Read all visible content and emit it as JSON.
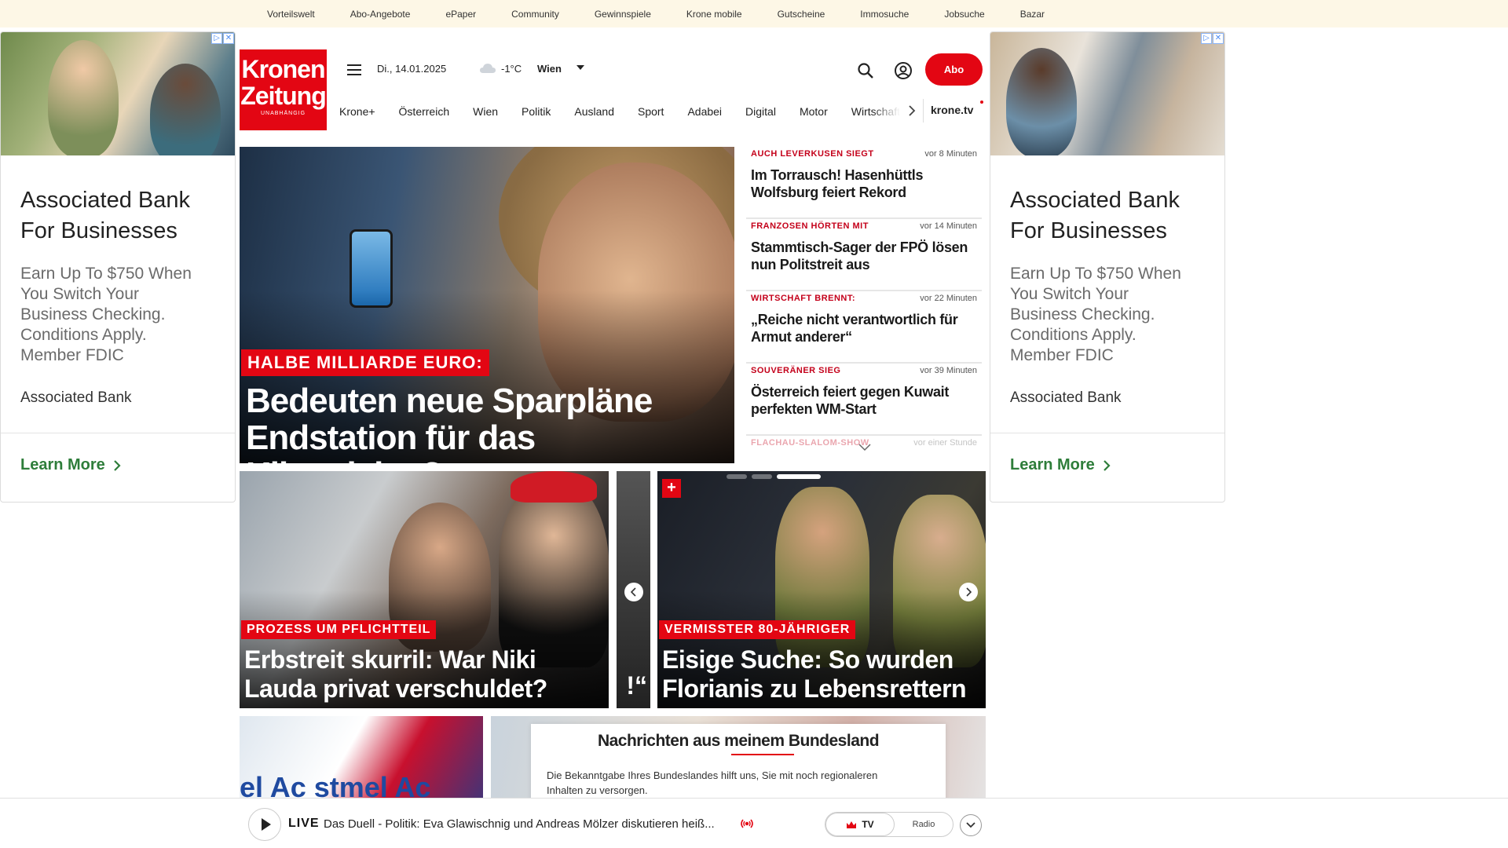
{
  "topbar": {
    "links": [
      "Vorteilswelt",
      "Abo-Angebote",
      "ePaper",
      "Community",
      "Gewinnspiele",
      "Krone mobile",
      "Gutscheine",
      "Immosuche",
      "Jobsuche",
      "Bazar"
    ]
  },
  "ads": {
    "left": {
      "title": "Associated Bank For Businesses",
      "body": "Earn Up To $750 When You Switch Your Business Checking. Conditions Apply. Member FDIC",
      "brand": "Associated Bank",
      "cta": "Learn More"
    },
    "right": {
      "title": "Associated Bank For Businesses",
      "body": "Earn Up To $750 When You Switch Your Business Checking. Conditions Apply. Member FDIC",
      "brand": "Associated Bank",
      "cta": "Learn More"
    }
  },
  "header": {
    "logo_line1": "Kronen",
    "logo_line2": "Zeitung",
    "logo_tagline": "UNABHÄNGIG",
    "date": "Di., 14.01.2025",
    "temperature": "-1°C",
    "city": "Wien",
    "abo_label": "Abo",
    "nav": [
      "Krone+",
      "Österreich",
      "Wien",
      "Politik",
      "Ausland",
      "Sport",
      "Adabei",
      "Digital",
      "Motor",
      "Wirtschaft"
    ],
    "nav_tv": "krone.tv"
  },
  "hero": {
    "kicker": "HALBE MILLIARDE EURO:",
    "title": "Bedeuten neue Sparpläne Endstation für das Klimaticket?"
  },
  "news": [
    {
      "kicker": "AUCH LEVERKUSEN SIEGT",
      "time": "vor 8 Minuten",
      "headline": "Im Torrausch! Hasenhüttls Wolfsburg feiert Rekord"
    },
    {
      "kicker": "FRANZOSEN HÖRTEN MIT",
      "time": "vor 14 Minuten",
      "headline": "Stammtisch-Sager der FPÖ lösen nun Politstreit aus"
    },
    {
      "kicker": "WIRTSCHAFT BRENNT:",
      "time": "vor 22 Minuten",
      "headline": "„Reiche nicht verantwortlich für Armut anderer“"
    },
    {
      "kicker": "SOUVERÄNER SIEG",
      "time": "vor 39 Minuten",
      "headline": "Österreich feiert gegen Kuwait perfekten WM-Start"
    },
    {
      "kicker": "FLACHAU-SLALOM-SHOW",
      "time": "vor einer Stunde",
      "headline": ""
    }
  ],
  "carousel": {
    "card1": {
      "kicker": "PROZESS UM PFLICHTTEIL",
      "title": "Erbstreit skurril: War Niki Lauda privat verschuldet?"
    },
    "card_mid": {
      "title": "!“"
    },
    "card2": {
      "plus": "+",
      "kicker": "VERMISSTER 80-JÄHRIGER",
      "title": "Eisige Suche: So wurden Florianis zu Lebensrettern"
    }
  },
  "tiles": {
    "tile1_text": "el Ac   stmel Ac"
  },
  "bundesland": {
    "title": "Nachrichten aus meinem Bundesland",
    "text": "Die Bekanntgabe Ihres Bundeslandes hilft uns, Sie mit noch regionaleren Inhalten zu versorgen."
  },
  "player": {
    "live_label": "LIVE",
    "live_text": "Das Duell - Politik: Eva Glawischnig und Andreas Mölzer diskutieren heiß...",
    "tv_label": "TV",
    "radio_label": "Radio"
  },
  "colors": {
    "brand_red": "#e30613",
    "topbar_bg": "#fdf7e6",
    "cta_green": "#2e7d3a"
  }
}
